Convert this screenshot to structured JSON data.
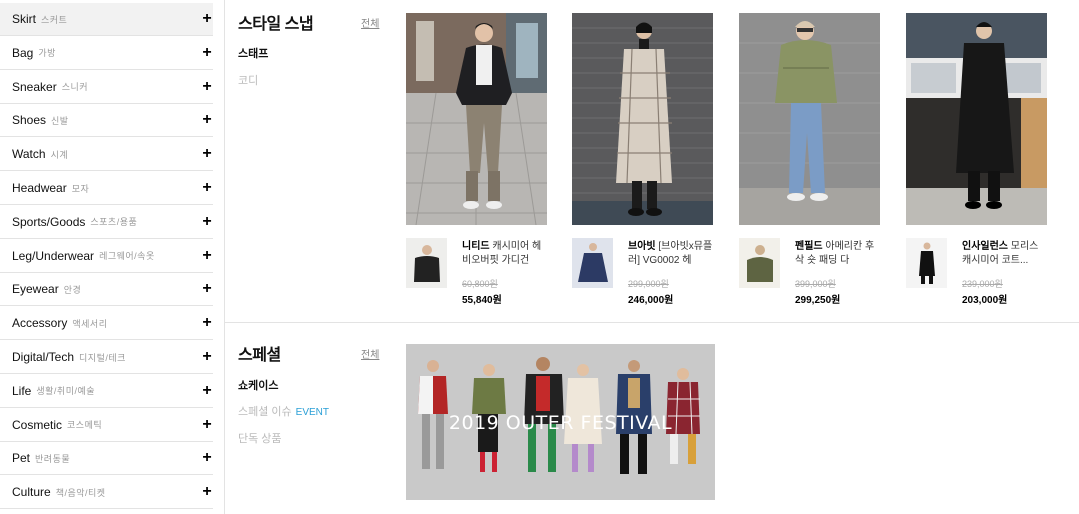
{
  "sidebar": {
    "items": [
      {
        "en": "Skirt",
        "ko": "스커트"
      },
      {
        "en": "Bag",
        "ko": "가방"
      },
      {
        "en": "Sneaker",
        "ko": "스니커"
      },
      {
        "en": "Shoes",
        "ko": "신발"
      },
      {
        "en": "Watch",
        "ko": "시계"
      },
      {
        "en": "Headwear",
        "ko": "모자"
      },
      {
        "en": "Sports/Goods",
        "ko": "스포츠/용품"
      },
      {
        "en": "Leg/Underwear",
        "ko": "레그웨어/속옷"
      },
      {
        "en": "Eyewear",
        "ko": "안경"
      },
      {
        "en": "Accessory",
        "ko": "액세서리"
      },
      {
        "en": "Digital/Tech",
        "ko": "디지털/테크"
      },
      {
        "en": "Life",
        "ko": "생활/취미/예술"
      },
      {
        "en": "Cosmetic",
        "ko": "코스메틱"
      },
      {
        "en": "Pet",
        "ko": "반려동물"
      },
      {
        "en": "Culture",
        "ko": "책/음악/티켓"
      }
    ],
    "plus": "+"
  },
  "style_snap": {
    "title": "스타일 스냅",
    "all_link": "전체",
    "subs": [
      "스태프",
      "코디"
    ],
    "products": [
      {
        "brand": "니티드",
        "name": "캐시미어 헤비오버핏 가디건",
        "old_price": "60,800원",
        "price": "55,840원"
      },
      {
        "brand": "브아빗",
        "name": "[브아빗x뮤플러] VG0002 헤",
        "old_price": "299,000원",
        "price": "246,000원"
      },
      {
        "brand": "펜필드",
        "name": "아메리칸 후삭 숏 패딩 다",
        "old_price": "399,000원",
        "price": "299,250원"
      },
      {
        "brand": "인사일런스",
        "name": "모리스 캐시미어 코트...",
        "old_price": "239,000원",
        "price": "203,000원"
      }
    ]
  },
  "special": {
    "title": "스페셜",
    "all_link": "전체",
    "subs": [
      "쇼케이스",
      "스페셜 이슈",
      "단독 상품"
    ],
    "event_tag": "EVENT",
    "banner_text": "2019 OUTER FESTIVAL"
  },
  "colors": {
    "accent": "#2a9fd6",
    "border": "#e3e3e3"
  }
}
